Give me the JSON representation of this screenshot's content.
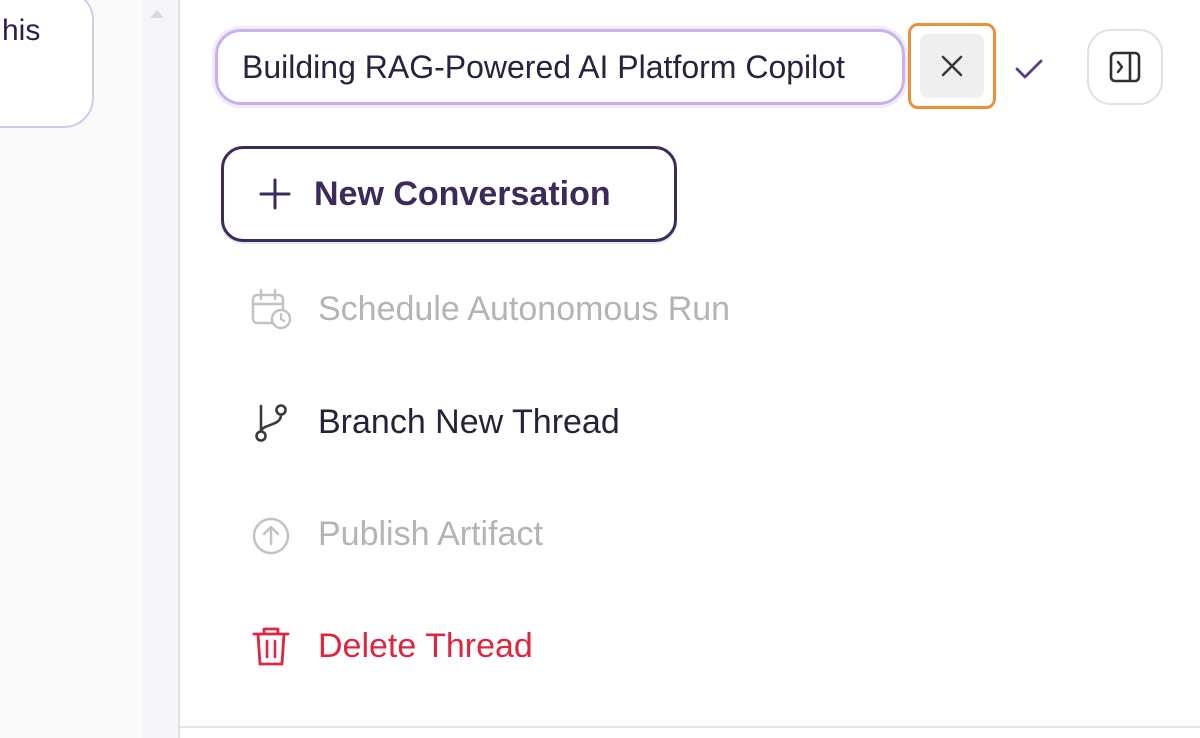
{
  "sidebar": {
    "card_text": "his"
  },
  "title_editor": {
    "value": "Building RAG-Powered AI Platform Copilot",
    "cancel_glyph": "×",
    "confirm_glyph": "✓"
  },
  "toolbar": {
    "new_conversation_label": "New Conversation"
  },
  "menu": {
    "items": [
      {
        "label": "Schedule Autonomous Run",
        "icon": "calendar-clock-icon",
        "state": "disabled"
      },
      {
        "label": "Branch New Thread",
        "icon": "git-branch-icon",
        "state": "enabled"
      },
      {
        "label": "Publish Artifact",
        "icon": "upload-circle-icon",
        "state": "disabled"
      },
      {
        "label": "Delete Thread",
        "icon": "trash-icon",
        "state": "danger"
      }
    ]
  },
  "colors": {
    "accent_purple": "#3b2a5a",
    "input_border": "#c9b2ec",
    "focus_ring": "#e8923a",
    "danger": "#e0263f",
    "disabled_text": "#b4b4b8"
  }
}
